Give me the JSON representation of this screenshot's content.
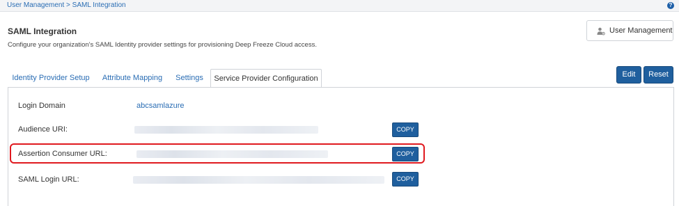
{
  "breadcrumb": {
    "parent": "User Management",
    "separator": ">",
    "current": "SAML Integration"
  },
  "help_icon_text": "?",
  "header": {
    "title": "SAML Integration",
    "description": "Configure your organization's SAML Identity provider settings for provisioning Deep Freeze Cloud access.",
    "user_management_button": "User Management"
  },
  "tabs": [
    {
      "label": "Identity Provider Setup",
      "active": false
    },
    {
      "label": "Attribute Mapping",
      "active": false
    },
    {
      "label": "Settings",
      "active": false
    },
    {
      "label": "Service Provider Configuration",
      "active": true
    }
  ],
  "actions": {
    "edit": "Edit",
    "reset": "Reset"
  },
  "fields": {
    "login_domain": {
      "label": "Login Domain",
      "value": "abcsamlazure"
    },
    "audience_uri": {
      "label": "Audience URI:",
      "copy": "COPY"
    },
    "assertion_consumer_url": {
      "label": "Assertion Consumer URL:",
      "copy": "COPY"
    },
    "saml_login_url": {
      "label": "SAML Login URL:",
      "copy": "COPY"
    }
  },
  "colors": {
    "accent": "#1f5f9e",
    "link": "#2a6db4",
    "highlight": "#e0191f"
  },
  "icons": {
    "help": "help-circle-icon",
    "user_management": "user-gear-icon"
  }
}
